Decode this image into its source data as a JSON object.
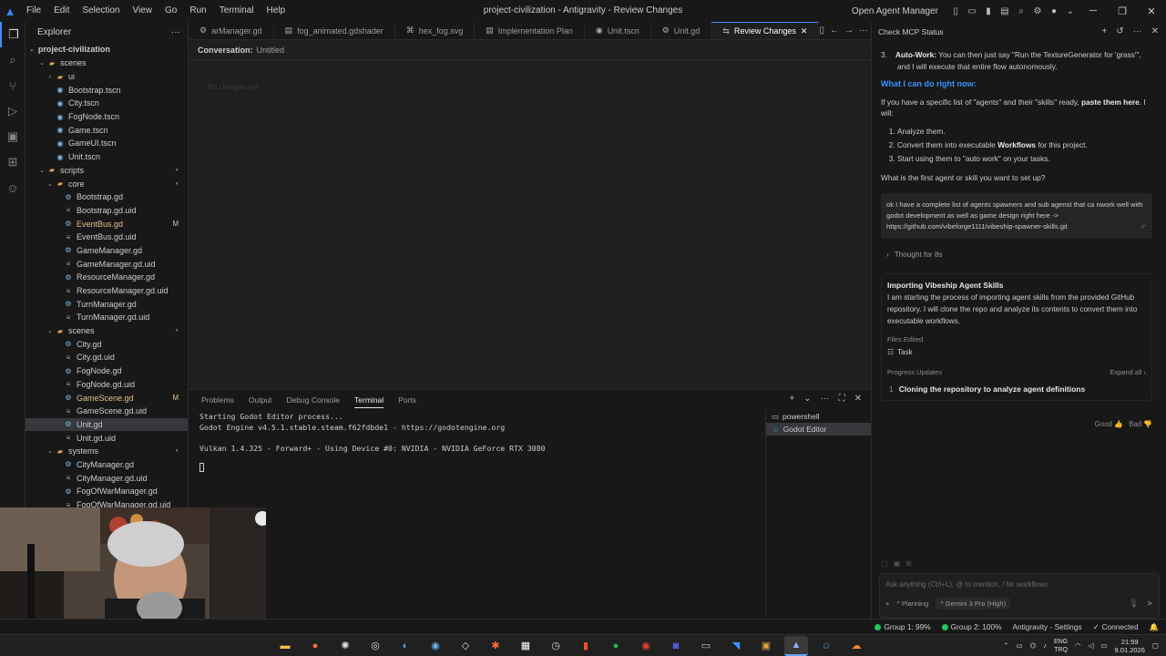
{
  "window": {
    "title": "project-civilization - Antigravity - Review Changes",
    "menu": [
      "File",
      "Edit",
      "Selection",
      "View",
      "Go",
      "Run",
      "Terminal",
      "Help"
    ],
    "open_agent_manager": "Open Agent Manager"
  },
  "sidebar": {
    "header": "Explorer",
    "project": "project-civilization",
    "tree": [
      {
        "label": "scenes",
        "indent": 1,
        "kind": "folder-open"
      },
      {
        "label": "ui",
        "indent": 2,
        "kind": "folder"
      },
      {
        "label": "Bootstrap.tscn",
        "indent": 2,
        "kind": "scene"
      },
      {
        "label": "City.tscn",
        "indent": 2,
        "kind": "scene"
      },
      {
        "label": "FogNode.tscn",
        "indent": 2,
        "kind": "scene"
      },
      {
        "label": "Game.tscn",
        "indent": 2,
        "kind": "scene"
      },
      {
        "label": "GameUI.tscn",
        "indent": 2,
        "kind": "scene"
      },
      {
        "label": "Unit.tscn",
        "indent": 2,
        "kind": "scene"
      },
      {
        "label": "scripts",
        "indent": 1,
        "kind": "folder-open",
        "mark": "dot"
      },
      {
        "label": "core",
        "indent": 2,
        "kind": "folder-open",
        "mark": "dot"
      },
      {
        "label": "Bootstrap.gd",
        "indent": 3,
        "kind": "gd"
      },
      {
        "label": "Bootstrap.gd.uid",
        "indent": 3,
        "kind": "uid"
      },
      {
        "label": "EventBus.gd",
        "indent": 3,
        "kind": "gd",
        "mark": "M",
        "modified": true
      },
      {
        "label": "EventBus.gd.uid",
        "indent": 3,
        "kind": "uid"
      },
      {
        "label": "GameManager.gd",
        "indent": 3,
        "kind": "gd"
      },
      {
        "label": "GameManager.gd.uid",
        "indent": 3,
        "kind": "uid"
      },
      {
        "label": "ResourceManager.gd",
        "indent": 3,
        "kind": "gd"
      },
      {
        "label": "ResourceManager.gd.uid",
        "indent": 3,
        "kind": "uid"
      },
      {
        "label": "TurnManager.gd",
        "indent": 3,
        "kind": "gd"
      },
      {
        "label": "TurnManager.gd.uid",
        "indent": 3,
        "kind": "uid"
      },
      {
        "label": "scenes",
        "indent": 2,
        "kind": "folder-open",
        "mark": "dot"
      },
      {
        "label": "City.gd",
        "indent": 3,
        "kind": "gd"
      },
      {
        "label": "City.gd.uid",
        "indent": 3,
        "kind": "uid"
      },
      {
        "label": "FogNode.gd",
        "indent": 3,
        "kind": "gd"
      },
      {
        "label": "FogNode.gd.uid",
        "indent": 3,
        "kind": "uid"
      },
      {
        "label": "GameScene.gd",
        "indent": 3,
        "kind": "gd",
        "mark": "M",
        "modified": true
      },
      {
        "label": "GameScene.gd.uid",
        "indent": 3,
        "kind": "uid"
      },
      {
        "label": "Unit.gd",
        "indent": 3,
        "kind": "gd",
        "selected": true
      },
      {
        "label": "Unit.gd.uid",
        "indent": 3,
        "kind": "uid"
      },
      {
        "label": "systems",
        "indent": 2,
        "kind": "folder-open",
        "mark": "dot"
      },
      {
        "label": "CityManager.gd",
        "indent": 3,
        "kind": "gd"
      },
      {
        "label": "CityManager.gd.uid",
        "indent": 3,
        "kind": "uid"
      },
      {
        "label": "FogOfWarManager.gd",
        "indent": 3,
        "kind": "gd"
      },
      {
        "label": "FogOfWarManager.gd.uid",
        "indent": 3,
        "kind": "uid"
      }
    ]
  },
  "tabs": [
    {
      "label": "arManager.gd",
      "icon": "gear-icon"
    },
    {
      "label": "fog_animated.gdshader",
      "icon": "file-icon"
    },
    {
      "label": "hex_fog.svg",
      "icon": "svg-icon"
    },
    {
      "label": "Implementation Plan",
      "icon": "doc-icon"
    },
    {
      "label": "Unit.tscn",
      "icon": "scene-icon"
    },
    {
      "label": "Unit.gd",
      "icon": "gear-icon"
    },
    {
      "label": "Review Changes",
      "icon": "review-icon",
      "active": true
    }
  ],
  "conversation": {
    "label": "Conversation:",
    "value": "Untitled",
    "empty_text": "No changes yet"
  },
  "panel": {
    "tabs": [
      "Problems",
      "Output",
      "Debug Console",
      "Terminal",
      "Ports"
    ],
    "active_tab": "Terminal",
    "terminal_lines": [
      "Starting Godot Editor process...",
      "Godot Engine v4.5.1.stable.steam.f62fdbde1 - https://godotengine.org",
      "",
      "Vulkan 1.4.325 - Forward+ - Using Device #0: NVIDIA - NVIDIA GeForce RTX 3080"
    ],
    "terminals": [
      "powershell",
      "Godot Editor"
    ]
  },
  "chat": {
    "header": "Check MCP Status",
    "auto_work_bold": "Auto-Work:",
    "auto_work_text": " You can then just say \"Run the TextureGenerator for 'grass'\", and I will execute that entire flow autonomously.",
    "heading": "What I can do right now:",
    "intro_a": "If you have a specific list of \"agents\" and their \"skills\" ready, ",
    "intro_bold": "paste them here",
    "intro_b": ". I will:",
    "list": [
      "Analyze them.",
      "Convert them into executable ",
      "Start using them to \"auto work\" on your tasks."
    ],
    "workflows_bold": "Workflows",
    "workflows_after": " for this project.",
    "question": "What is the first agent or skill you want to set up?",
    "user_message": "ok I have a complete list of agents spawners and sub agenst that ca nwork well with godot development as well as game design right here -> https://github.com/vibeforge1111/vibeship-spawner-skills.git",
    "thought": "Thought for 8s",
    "card_title": "Importing Vibeship Agent Skills",
    "card_text": "I am starting the process of importing agent skills from the provided GitHub repository. I will clone the repo and analyze its contents to convert them into executable workflows.",
    "files_edited": "Files Edited",
    "task_file": "Task",
    "progress_updates": "Progress Updates",
    "expand_all": "Expand all",
    "step_num": "1",
    "step_text": "Cloning the repository to analyze agent definitions",
    "good": "Good",
    "bad": "Bad",
    "input_placeholder": "Ask anything (Ctrl+L), @ to mention, / for workflows",
    "mode": "Planning",
    "model": "Gemini 3 Pro (High)"
  },
  "status_bar": {
    "group1": "Group 1: 99%",
    "group2": "Group 2: 100%",
    "settings": "Antigravity - Settings",
    "connected": "Connected"
  },
  "taskbar": {
    "lang1": "ENG",
    "lang2": "TRQ",
    "time": "21:59",
    "date": "9.01.2026"
  },
  "colors": {
    "accent": "#3794ff",
    "modified": "#e2c08d",
    "status_ok": "#22c55e"
  }
}
